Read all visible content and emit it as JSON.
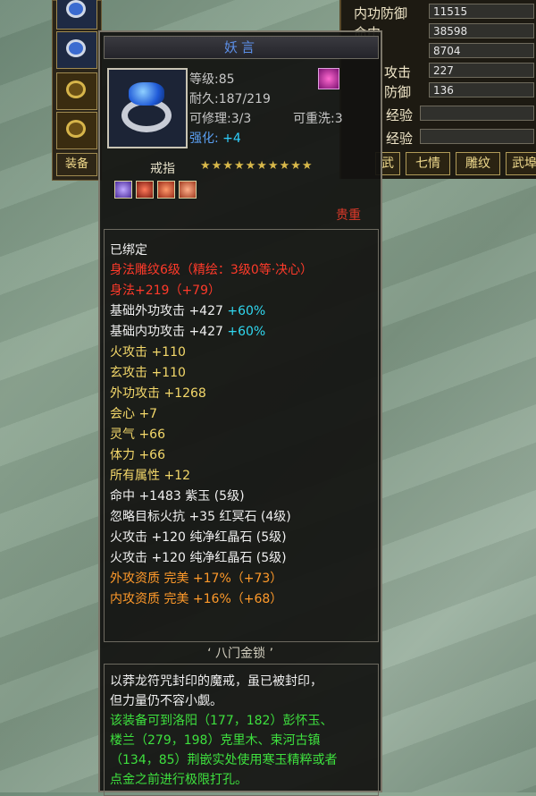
{
  "equip_tab": "装备",
  "stats_panel": {
    "rows": [
      {
        "label": "内功防御",
        "value": "11515"
      },
      {
        "label": "命中",
        "value": "38598"
      },
      {
        "label": "",
        "value": "8704"
      },
      {
        "label": "攻击",
        "value": "227"
      },
      {
        "label": "防御",
        "value": "136"
      },
      {
        "label": "经验",
        "value": ""
      },
      {
        "label": "经验",
        "value": ""
      }
    ],
    "tabs": [
      "武",
      "七情",
      "雕纹",
      "武埠"
    ]
  },
  "tooltip": {
    "name": "妖言",
    "level": "等级:85",
    "durability": "耐久:187/219",
    "repairable": "可修理:3/3",
    "rewashable": "可重洗:3",
    "strength_label": "强化:",
    "strength_value": "+4",
    "type": "戒指",
    "stars": "★★★★★★★★★★",
    "rarity": "贵重",
    "attributes": [
      {
        "text": "已绑定",
        "color": "white"
      },
      {
        "text": "身法雕纹6级（精绘：3级0等·决心）",
        "color": "red"
      },
      {
        "text": "身法+219（+79）",
        "color": "red"
      },
      {
        "text": "基础外功攻击 +427",
        "extra": "+60%",
        "color": "white"
      },
      {
        "text": "基础内功攻击 +427",
        "extra": "+60%",
        "color": "white"
      },
      {
        "text": "火攻击 +110",
        "color": "yellow"
      },
      {
        "text": "玄攻击 +110",
        "color": "yellow"
      },
      {
        "text": "外功攻击 +1268",
        "color": "yellow"
      },
      {
        "text": "会心 +7",
        "color": "yellow"
      },
      {
        "text": "灵气 +66",
        "color": "yellow"
      },
      {
        "text": "体力 +66",
        "color": "yellow"
      },
      {
        "text": "所有属性 +12",
        "color": "yellow"
      },
      {
        "text": "命中 +1483 紫玉 (5级)",
        "color": "white"
      },
      {
        "text": "忽略目标火抗 +35 红冥石 (4级)",
        "color": "white"
      },
      {
        "text": "火攻击 +120 纯净红晶石 (5级)",
        "color": "white"
      },
      {
        "text": "火攻击 +120 纯净红晶石 (5级)",
        "color": "white"
      },
      {
        "text": "外攻资质  完美 +17%（+73）",
        "color": "orange"
      },
      {
        "text": "内攻资质  完美 +16%（+68）",
        "color": "orange"
      }
    ],
    "set_title": "‘ 八门金锁 ’",
    "description": [
      {
        "text": "以莽龙符咒封印的魔戒，虽已被封印，",
        "color": "white"
      },
      {
        "text": "但力量仍不容小觑。",
        "color": "white"
      },
      {
        "text": "该装备可到洛阳（177，182）彭怀玉、",
        "color": "green"
      },
      {
        "text": "楼兰（279，198）克里木、束河古镇",
        "color": "green"
      },
      {
        "text": "（134，85）荆嵌实处使用寒玉精粹或者",
        "color": "green"
      },
      {
        "text": "点金之前进行极限打孔。",
        "color": "green"
      }
    ]
  }
}
